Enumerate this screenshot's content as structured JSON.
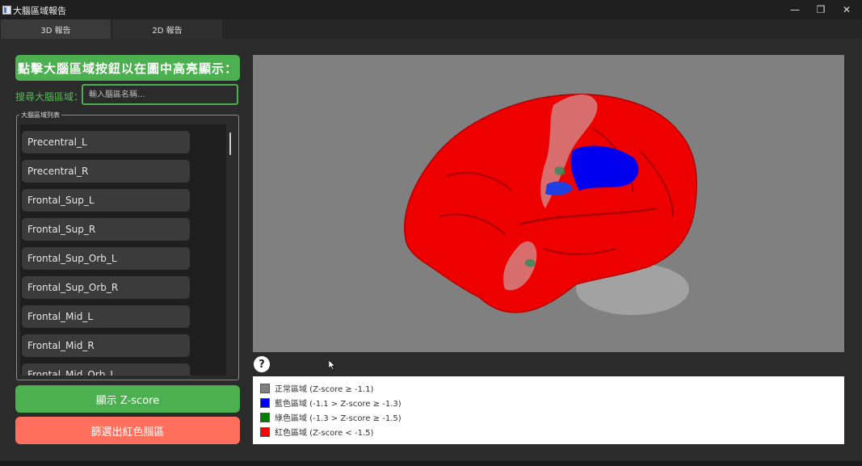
{
  "window": {
    "title": "大腦區域報告",
    "min_icon": "minimize-icon",
    "max_icon": "restore-icon",
    "close_icon": "close-icon"
  },
  "tabs": [
    {
      "label": "3D 報告",
      "active": true
    },
    {
      "label": "2D 報告",
      "active": false
    }
  ],
  "header": {
    "banner": "點擊大腦區域按鈕以在圖中高亮顯示："
  },
  "search": {
    "label": "搜尋大腦區域：",
    "placeholder": "輸入腦區名稱..."
  },
  "region_group": {
    "title": "大腦區域列表",
    "items": [
      "Precentral_L",
      "Precentral_R",
      "Frontal_Sup_L",
      "Frontal_Sup_R",
      "Frontal_Sup_Orb_L",
      "Frontal_Sup_Orb_R",
      "Frontal_Mid_L",
      "Frontal_Mid_R",
      "Frontal_Mid_Orb_L"
    ]
  },
  "actions": {
    "show_zscore": "顯示 Z-score",
    "filter_red": "篩選出紅色腦區"
  },
  "help": {
    "label": "?"
  },
  "legend": [
    {
      "color": "#808080",
      "text": "正常區域 (Z-score ≥ -1.1)"
    },
    {
      "color": "#0000ff",
      "text": "藍色區域 (-1.1 > Z-score ≥ -1.3)"
    },
    {
      "color": "#008000",
      "text": "綠色區域 (-1.3 > Z-score ≥ -1.5)"
    },
    {
      "color": "#ff0000",
      "text": "紅色區域 (Z-score < -1.5)"
    }
  ],
  "colors": {
    "accent_green": "#4caf50",
    "accent_red": "#ff6f5e",
    "viewer_bg": "#808080"
  }
}
